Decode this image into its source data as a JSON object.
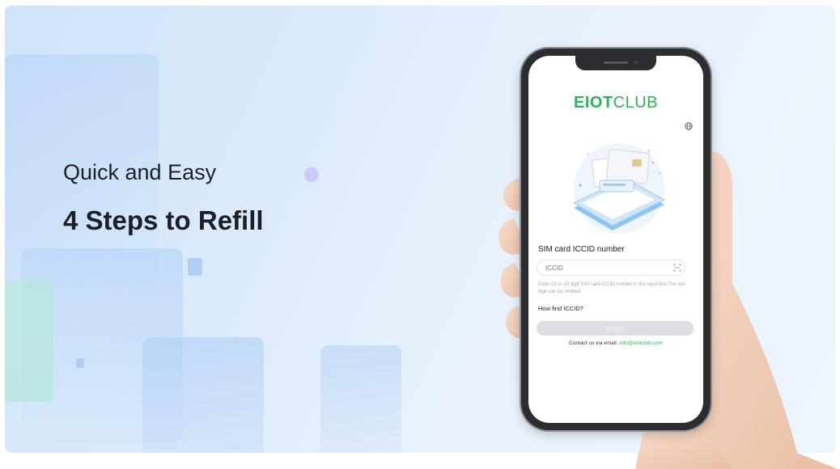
{
  "banner": {
    "subtitle": "Quick and Easy",
    "title": "4 Steps to Refill"
  },
  "app": {
    "logo_bold": "EIOT",
    "logo_light": "CLUB",
    "iccid_label": "SIM card ICCID number",
    "iccid_placeholder": "ICCID",
    "hint": "Enter 19 or 20 digit SIM card ICCID number in the input box.The last digit can be omitted",
    "how_find_link": "How find ICCID?",
    "search_button": "Search",
    "contact_prefix": "Contact us via email:",
    "contact_email": "info@eiotclub.com"
  },
  "icons": [
    "globe-icon",
    "scan-icon",
    "sim-card-illustration"
  ],
  "colors": {
    "brand_green": "#2bb25c",
    "background": "#dcebfb",
    "button_disabled": "#dcdee1"
  }
}
